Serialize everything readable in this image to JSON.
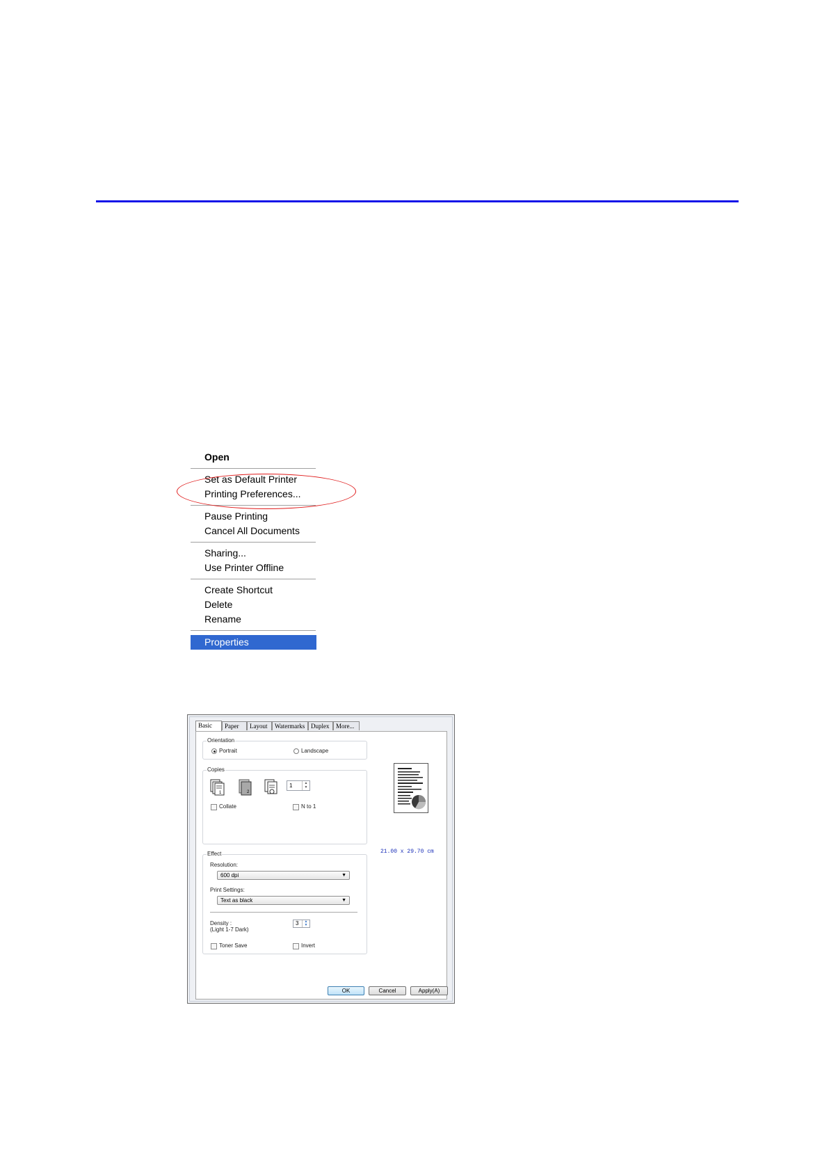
{
  "context_menu": {
    "items": [
      {
        "label": "Open"
      },
      {
        "label": "Set as Default Printer"
      },
      {
        "label": "Printing Preferences..."
      },
      {
        "label": "Pause Printing"
      },
      {
        "label": "Cancel All Documents"
      },
      {
        "label": "Sharing..."
      },
      {
        "label": "Use Printer Offline"
      },
      {
        "label": "Create Shortcut"
      },
      {
        "label": "Delete"
      },
      {
        "label": "Rename"
      },
      {
        "label": "Properties"
      }
    ],
    "highlighted": "Printing Preferences...",
    "selected": "Properties"
  },
  "dialog": {
    "tabs": [
      {
        "label": "Basic"
      },
      {
        "label": "Paper"
      },
      {
        "label": "Layout"
      },
      {
        "label": "Watermarks"
      },
      {
        "label": "Duplex"
      },
      {
        "label": "More..."
      }
    ],
    "orientation": {
      "title": "Orientation",
      "portrait": "Portrait",
      "landscape": "Landscape",
      "selected": "Portrait"
    },
    "copies": {
      "title": "Copies",
      "value": "1",
      "collate": "Collate",
      "n_to_1": "N to 1"
    },
    "paper_size": "21.00 x 29.70 cm",
    "effect": {
      "title": "Effect",
      "resolution_label": "Resolution:",
      "resolution_value": "600 dpi",
      "print_settings_label": "Print Settings:",
      "print_settings_value": "Text as black",
      "density_label": "Density :",
      "density_range": "(Light 1-7 Dark)",
      "density_value": "3",
      "toner_save": "Toner Save",
      "invert": "Invert"
    },
    "buttons": {
      "ok": "OK",
      "cancel": "Cancel",
      "apply": "Apply(A)"
    }
  },
  "colors": {
    "rule": "#1414e8",
    "highlight_oval": "#e01a1a",
    "menu_selection": "#3068d0"
  }
}
